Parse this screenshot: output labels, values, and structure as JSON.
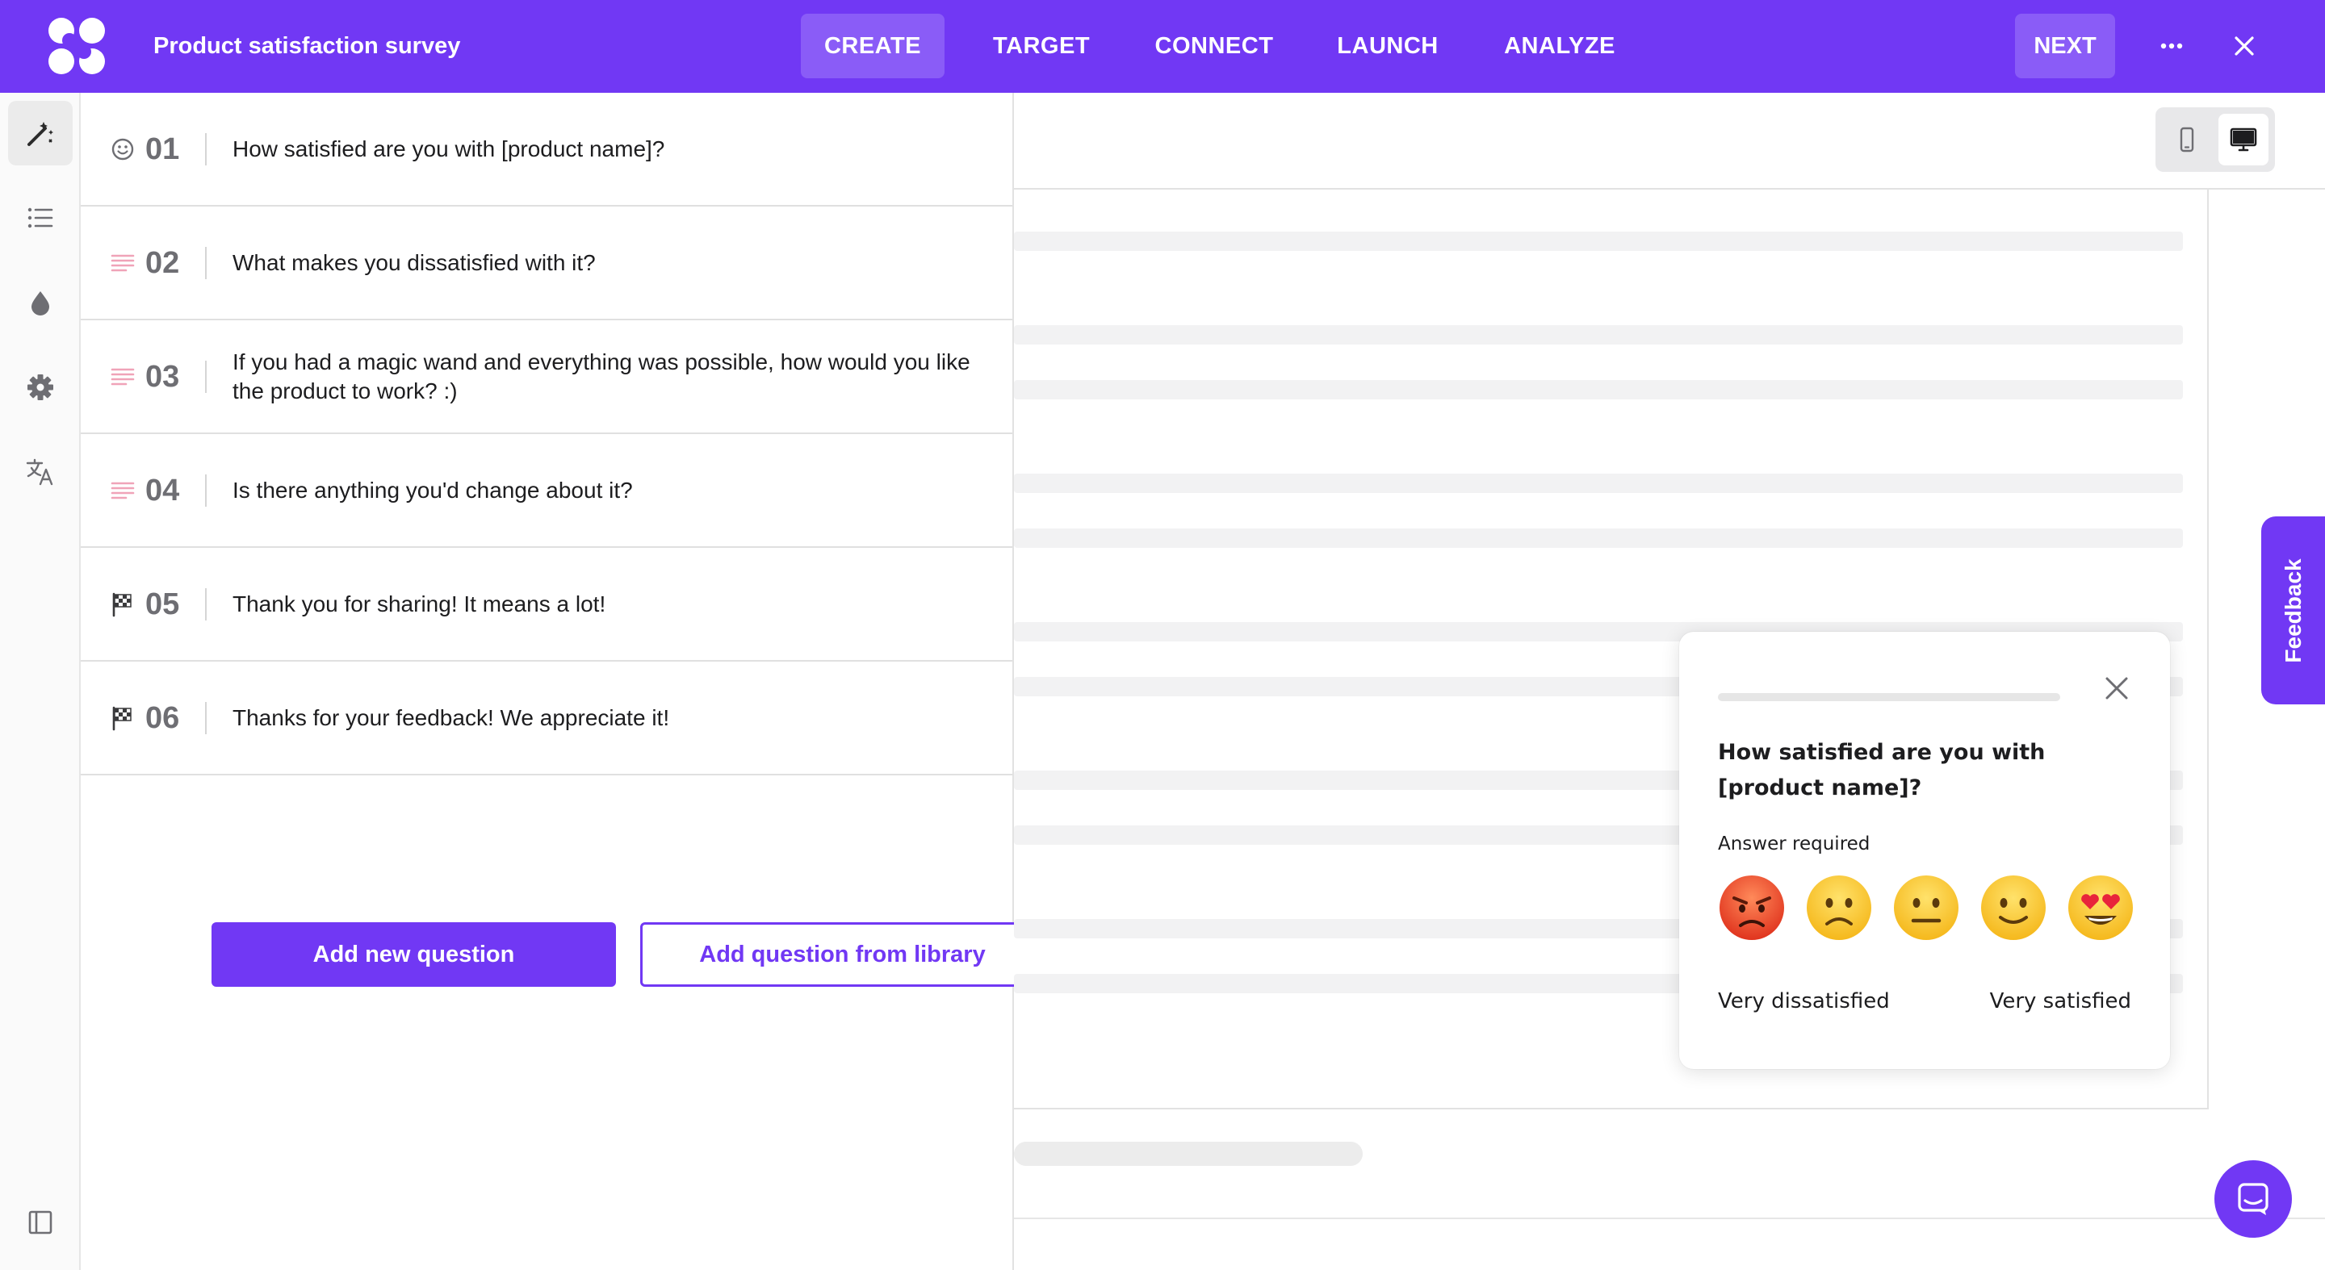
{
  "app": {
    "survey_title": "Product satisfaction survey",
    "brand_color": "#7138f4"
  },
  "nav": {
    "tabs": [
      {
        "label": "CREATE",
        "active": true
      },
      {
        "label": "TARGET",
        "active": false
      },
      {
        "label": "CONNECT",
        "active": false
      },
      {
        "label": "LAUNCH",
        "active": false
      },
      {
        "label": "ANALYZE",
        "active": false
      }
    ],
    "next_label": "NEXT",
    "more_icon": "more-horizontal-icon",
    "close_icon": "close-icon"
  },
  "sidebar": {
    "items": [
      {
        "icon": "magic-wand-icon",
        "active": true
      },
      {
        "icon": "list-icon",
        "active": false
      },
      {
        "icon": "droplet-icon",
        "active": false
      },
      {
        "icon": "gear-icon",
        "active": false
      },
      {
        "icon": "translate-icon",
        "active": false
      }
    ],
    "bottom_icon": "collapse-panel-icon"
  },
  "questions": [
    {
      "number": "01",
      "type_icon": "smiley-icon",
      "text": "How satisfied are you with [product name]?"
    },
    {
      "number": "02",
      "type_icon": "text-lines-icon",
      "text": "What makes you dissatisfied with it?"
    },
    {
      "number": "03",
      "type_icon": "text-lines-icon",
      "text": "If you had a magic wand and everything was possible, how would you like the product to work? :)"
    },
    {
      "number": "04",
      "type_icon": "text-lines-icon",
      "text": "Is there anything you'd change about it?"
    },
    {
      "number": "05",
      "type_icon": "checkered-flag-icon",
      "text": "Thank you for sharing! It means a lot!"
    },
    {
      "number": "06",
      "type_icon": "checkered-flag-icon",
      "text": "Thanks for your feedback! We appreciate it!"
    }
  ],
  "actions": {
    "add_new": "Add new question",
    "add_from_library": "Add question from library"
  },
  "preview": {
    "devices": [
      {
        "icon": "mobile-icon",
        "active": false
      },
      {
        "icon": "desktop-icon",
        "active": true
      }
    ],
    "popup": {
      "question": "How satisfied are you with [product name]?",
      "required_label": "Answer required",
      "emojis": [
        "angry-face",
        "slightly-frowning-face",
        "neutral-face",
        "slightly-smiling-face",
        "heart-eyes-face"
      ],
      "scale_low": "Very dissatisfied",
      "scale_high": "Very satisfied"
    },
    "feedback_tab": "Feedback",
    "chat_icon": "chat-bubble-icon"
  }
}
